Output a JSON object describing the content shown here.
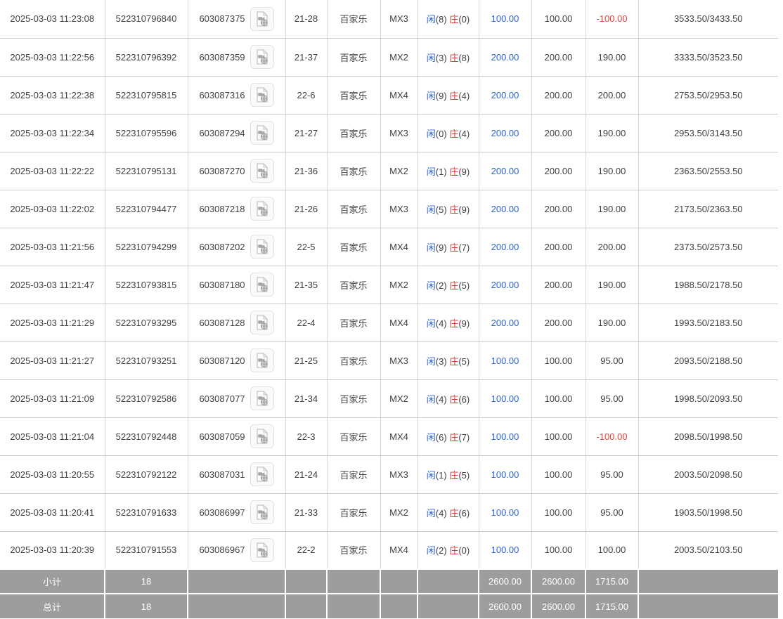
{
  "colors": {
    "link_blue": "#2e63d4",
    "banker_red": "#d03a34",
    "loss_red": "#e6403a",
    "summary_bg": "#9d9d9d",
    "row_text": "#404040"
  },
  "rows": [
    {
      "time": "2025-03-03 11:23:08",
      "bet_id": "522310796840",
      "round_id": "603087375",
      "round_no": "21-28",
      "game": "百家乐",
      "table_no": "MX3",
      "player": "闲",
      "player_pts": "(8)",
      "banker": "庄",
      "banker_pts": "(0)",
      "bet_amount": "100.00",
      "valid_amount": "100.00",
      "win_loss": "-100.00",
      "balance": "3533.50/3433.50"
    },
    {
      "time": "2025-03-03 11:22:56",
      "bet_id": "522310796392",
      "round_id": "603087359",
      "round_no": "21-37",
      "game": "百家乐",
      "table_no": "MX2",
      "player": "闲",
      "player_pts": "(3)",
      "banker": "庄",
      "banker_pts": "(8)",
      "bet_amount": "200.00",
      "valid_amount": "200.00",
      "win_loss": "190.00",
      "balance": "3333.50/3523.50"
    },
    {
      "time": "2025-03-03 11:22:38",
      "bet_id": "522310795815",
      "round_id": "603087316",
      "round_no": "22-6",
      "game": "百家乐",
      "table_no": "MX4",
      "player": "闲",
      "player_pts": "(9)",
      "banker": "庄",
      "banker_pts": "(4)",
      "bet_amount": "200.00",
      "valid_amount": "200.00",
      "win_loss": "200.00",
      "balance": "2753.50/2953.50"
    },
    {
      "time": "2025-03-03 11:22:34",
      "bet_id": "522310795596",
      "round_id": "603087294",
      "round_no": "21-27",
      "game": "百家乐",
      "table_no": "MX3",
      "player": "闲",
      "player_pts": "(0)",
      "banker": "庄",
      "banker_pts": "(4)",
      "bet_amount": "200.00",
      "valid_amount": "200.00",
      "win_loss": "190.00",
      "balance": "2953.50/3143.50"
    },
    {
      "time": "2025-03-03 11:22:22",
      "bet_id": "522310795131",
      "round_id": "603087270",
      "round_no": "21-36",
      "game": "百家乐",
      "table_no": "MX2",
      "player": "闲",
      "player_pts": "(1)",
      "banker": "庄",
      "banker_pts": "(9)",
      "bet_amount": "200.00",
      "valid_amount": "200.00",
      "win_loss": "190.00",
      "balance": "2363.50/2553.50"
    },
    {
      "time": "2025-03-03 11:22:02",
      "bet_id": "522310794477",
      "round_id": "603087218",
      "round_no": "21-26",
      "game": "百家乐",
      "table_no": "MX3",
      "player": "闲",
      "player_pts": "(5)",
      "banker": "庄",
      "banker_pts": "(9)",
      "bet_amount": "200.00",
      "valid_amount": "200.00",
      "win_loss": "190.00",
      "balance": "2173.50/2363.50"
    },
    {
      "time": "2025-03-03 11:21:56",
      "bet_id": "522310794299",
      "round_id": "603087202",
      "round_no": "22-5",
      "game": "百家乐",
      "table_no": "MX4",
      "player": "闲",
      "player_pts": "(9)",
      "banker": "庄",
      "banker_pts": "(7)",
      "bet_amount": "200.00",
      "valid_amount": "200.00",
      "win_loss": "200.00",
      "balance": "2373.50/2573.50"
    },
    {
      "time": "2025-03-03 11:21:47",
      "bet_id": "522310793815",
      "round_id": "603087180",
      "round_no": "21-35",
      "game": "百家乐",
      "table_no": "MX2",
      "player": "闲",
      "player_pts": "(2)",
      "banker": "庄",
      "banker_pts": "(5)",
      "bet_amount": "200.00",
      "valid_amount": "200.00",
      "win_loss": "190.00",
      "balance": "1988.50/2178.50"
    },
    {
      "time": "2025-03-03 11:21:29",
      "bet_id": "522310793295",
      "round_id": "603087128",
      "round_no": "22-4",
      "game": "百家乐",
      "table_no": "MX4",
      "player": "闲",
      "player_pts": "(4)",
      "banker": "庄",
      "banker_pts": "(9)",
      "bet_amount": "200.00",
      "valid_amount": "200.00",
      "win_loss": "190.00",
      "balance": "1993.50/2183.50"
    },
    {
      "time": "2025-03-03 11:21:27",
      "bet_id": "522310793251",
      "round_id": "603087120",
      "round_no": "21-25",
      "game": "百家乐",
      "table_no": "MX3",
      "player": "闲",
      "player_pts": "(3)",
      "banker": "庄",
      "banker_pts": "(5)",
      "bet_amount": "100.00",
      "valid_amount": "100.00",
      "win_loss": "95.00",
      "balance": "2093.50/2188.50"
    },
    {
      "time": "2025-03-03 11:21:09",
      "bet_id": "522310792586",
      "round_id": "603087077",
      "round_no": "21-34",
      "game": "百家乐",
      "table_no": "MX2",
      "player": "闲",
      "player_pts": "(4)",
      "banker": "庄",
      "banker_pts": "(6)",
      "bet_amount": "100.00",
      "valid_amount": "100.00",
      "win_loss": "95.00",
      "balance": "1998.50/2093.50"
    },
    {
      "time": "2025-03-03 11:21:04",
      "bet_id": "522310792448",
      "round_id": "603087059",
      "round_no": "22-3",
      "game": "百家乐",
      "table_no": "MX4",
      "player": "闲",
      "player_pts": "(6)",
      "banker": "庄",
      "banker_pts": "(7)",
      "bet_amount": "100.00",
      "valid_amount": "100.00",
      "win_loss": "-100.00",
      "balance": "2098.50/1998.50"
    },
    {
      "time": "2025-03-03 11:20:55",
      "bet_id": "522310792122",
      "round_id": "603087031",
      "round_no": "21-24",
      "game": "百家乐",
      "table_no": "MX3",
      "player": "闲",
      "player_pts": "(1)",
      "banker": "庄",
      "banker_pts": "(5)",
      "bet_amount": "100.00",
      "valid_amount": "100.00",
      "win_loss": "95.00",
      "balance": "2003.50/2098.50"
    },
    {
      "time": "2025-03-03 11:20:41",
      "bet_id": "522310791633",
      "round_id": "603086997",
      "round_no": "21-33",
      "game": "百家乐",
      "table_no": "MX2",
      "player": "闲",
      "player_pts": "(4)",
      "banker": "庄",
      "banker_pts": "(6)",
      "bet_amount": "100.00",
      "valid_amount": "100.00",
      "win_loss": "95.00",
      "balance": "1903.50/1998.50"
    },
    {
      "time": "2025-03-03 11:20:39",
      "bet_id": "522310791553",
      "round_id": "603086967",
      "round_no": "22-2",
      "game": "百家乐",
      "table_no": "MX4",
      "player": "闲",
      "player_pts": "(2)",
      "banker": "庄",
      "banker_pts": "(0)",
      "bet_amount": "100.00",
      "valid_amount": "100.00",
      "win_loss": "100.00",
      "balance": "2003.50/2103.50"
    }
  ],
  "summary": {
    "subtotal_label": "小计",
    "subtotal_count": "18",
    "subtotal_bet": "2600.00",
    "subtotal_valid": "2600.00",
    "subtotal_winloss": "1715.00",
    "total_label": "总计",
    "total_count": "18",
    "total_bet": "2600.00",
    "total_valid": "2600.00",
    "total_winloss": "1715.00"
  }
}
